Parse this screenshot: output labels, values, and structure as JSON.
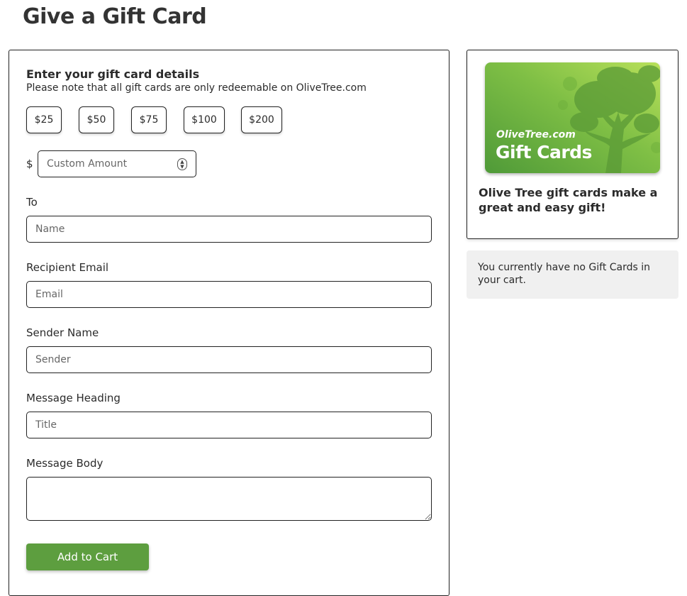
{
  "page": {
    "title": "Give a Gift Card"
  },
  "form": {
    "heading": "Enter your gift card details",
    "note": "Please note that all gift cards are only redeemable on OliveTree.com",
    "amounts": [
      "$25",
      "$50",
      "$75",
      "$100",
      "$200"
    ],
    "currency_symbol": "$",
    "custom_amount_placeholder": "Custom Amount",
    "to_label": "To",
    "to_placeholder": "Name",
    "email_label": "Recipient Email",
    "email_placeholder": "Email",
    "sender_label": "Sender Name",
    "sender_placeholder": "Sender",
    "heading_label": "Message Heading",
    "heading_placeholder": "Title",
    "body_label": "Message Body",
    "submit_label": "Add to Cart"
  },
  "promo": {
    "card_domain": "OliveTree.com",
    "card_title": "Gift Cards",
    "tagline": "Olive Tree gift cards make a great and easy gift!"
  },
  "cart": {
    "status": "You currently have no Gift Cards in your cart."
  },
  "colors": {
    "accent_green": "#5d9e3f",
    "card_green_light": "#b8e05a",
    "card_green_dark": "#4f9a38"
  }
}
